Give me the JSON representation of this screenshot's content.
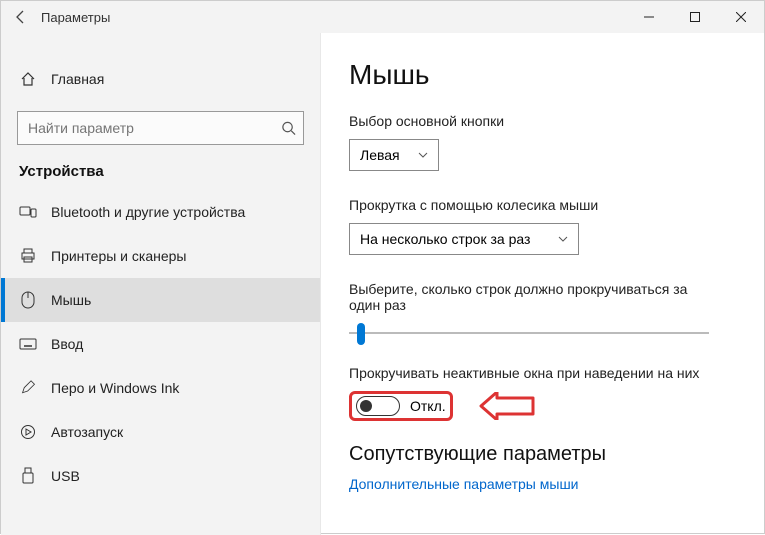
{
  "titlebar": {
    "title": "Параметры"
  },
  "sidebar": {
    "home_label": "Главная",
    "search_placeholder": "Найти параметр",
    "section_title": "Устройства",
    "items": [
      {
        "label": "Bluetooth и другие устройства"
      },
      {
        "label": "Принтеры и сканеры"
      },
      {
        "label": "Мышь"
      },
      {
        "label": "Ввод"
      },
      {
        "label": "Перо и Windows Ink"
      },
      {
        "label": "Автозапуск"
      },
      {
        "label": "USB"
      }
    ]
  },
  "main": {
    "heading": "Мышь",
    "primary_button_label": "Выбор основной кнопки",
    "primary_button_value": "Левая",
    "scroll_mode_label": "Прокрутка с помощью колесика мыши",
    "scroll_mode_value": "На несколько строк за раз",
    "lines_label": "Выберите, сколько строк должно прокручиваться за один раз",
    "inactive_scroll_label": "Прокручивать неактивные окна при наведении на них",
    "toggle_state": "Откл.",
    "related_heading": "Сопутствующие параметры",
    "related_link": "Дополнительные параметры мыши"
  }
}
